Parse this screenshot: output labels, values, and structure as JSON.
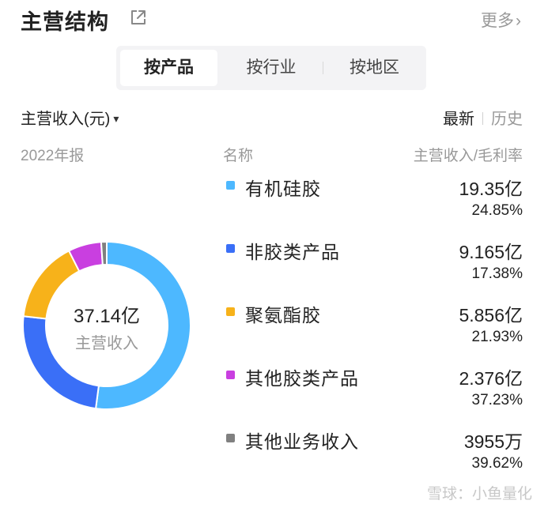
{
  "header": {
    "title": "主营结构",
    "more_label": "更多",
    "more_chevron": "›"
  },
  "tabs": [
    {
      "label": "按产品",
      "selected": true
    },
    {
      "label": "按行业",
      "selected": false
    },
    {
      "label": "按地区",
      "selected": false
    }
  ],
  "metric_selector": {
    "label": "主营收入(元)",
    "caret": "▾"
  },
  "mode": {
    "latest": "最新",
    "history": "历史"
  },
  "table_header": {
    "period": "2022年报",
    "name_col": "名称",
    "value_col": "主营收入/毛利率"
  },
  "donut_center": {
    "value": "37.14亿",
    "label": "主营收入"
  },
  "chart_data": {
    "type": "pie",
    "unit": "亿",
    "total": 37.14,
    "series": [
      {
        "name": "有机硅胶",
        "value": 19.35,
        "value_label": "19.35亿",
        "margin": "24.85%",
        "color": "#4db8ff"
      },
      {
        "name": "非胶类产品",
        "value": 9.165,
        "value_label": "9.165亿",
        "margin": "17.38%",
        "color": "#3a6ff7"
      },
      {
        "name": "聚氨酯胶",
        "value": 5.856,
        "value_label": "5.856亿",
        "margin": "21.93%",
        "color": "#f7b21a"
      },
      {
        "name": "其他胶类产品",
        "value": 2.376,
        "value_label": "2.376亿",
        "margin": "37.23%",
        "color": "#c93fe0"
      },
      {
        "name": "其他业务收入",
        "value": 0.3955,
        "value_label": "3955万",
        "margin": "39.62%",
        "color": "#808080"
      }
    ]
  },
  "watermark": "雪球：小鱼量化"
}
